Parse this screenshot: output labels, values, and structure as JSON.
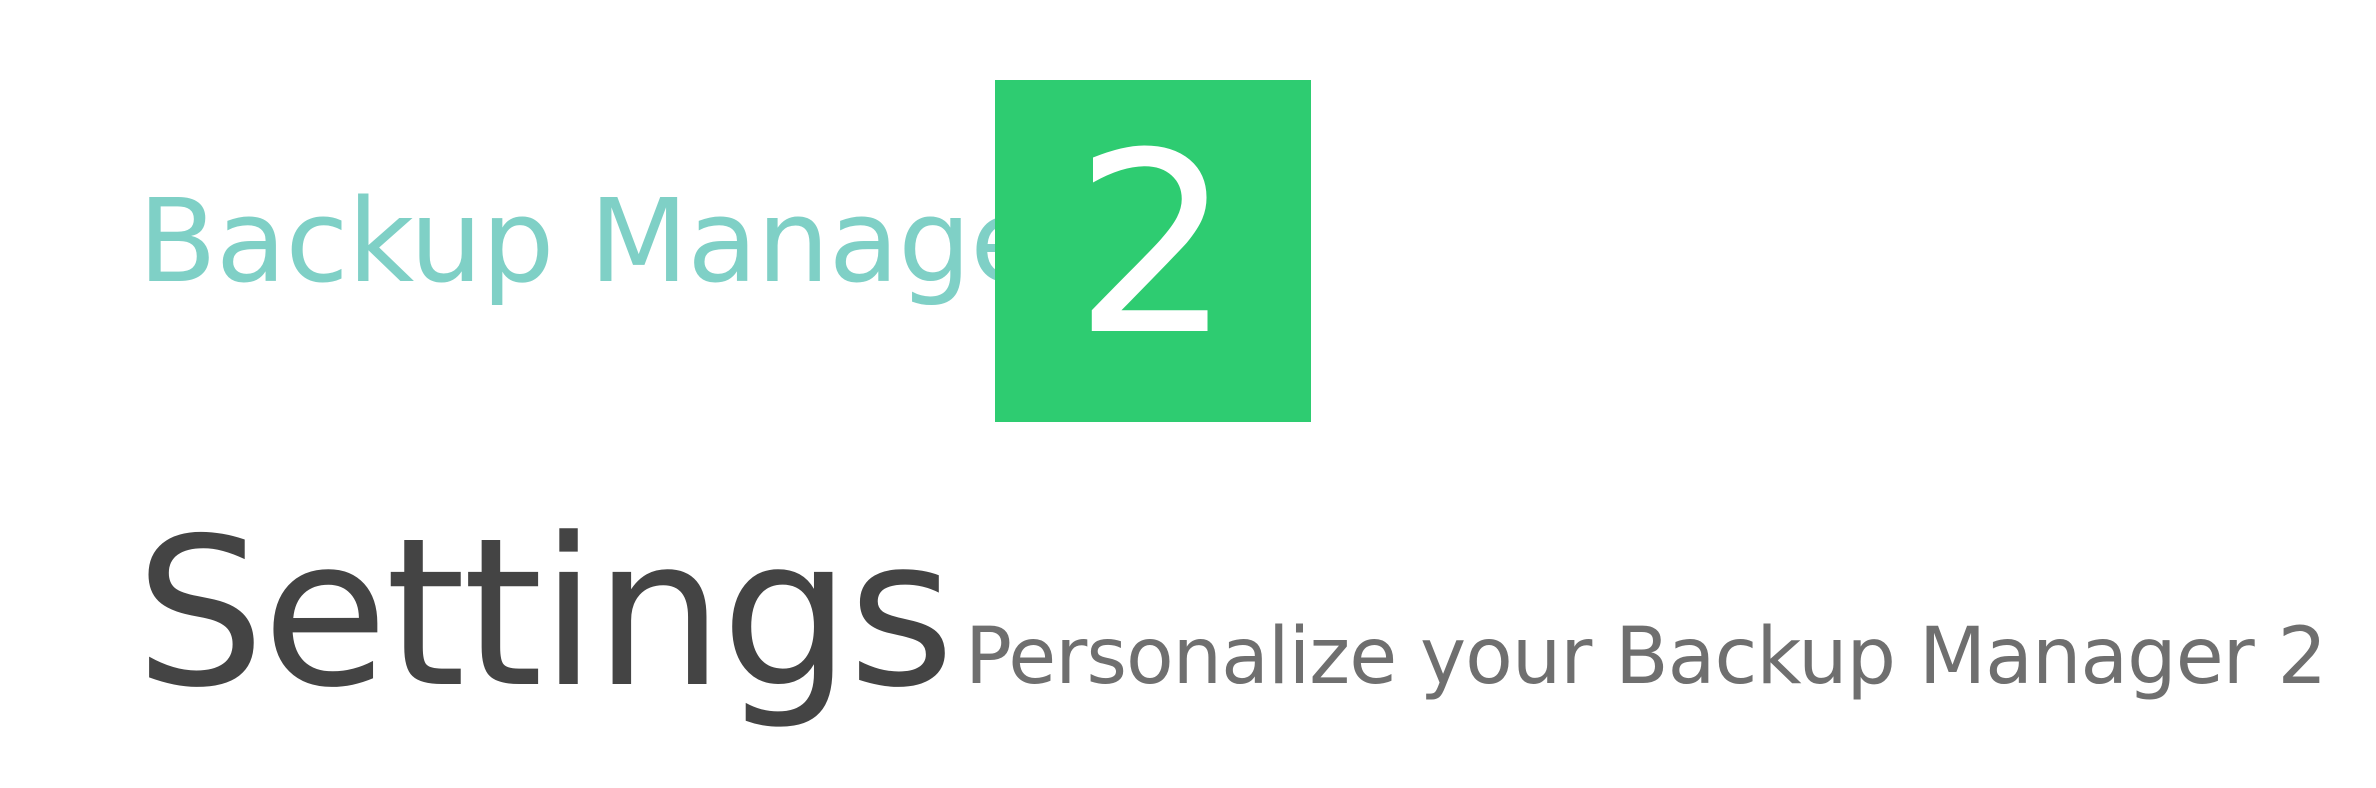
{
  "header": {
    "app_name": "Backup Manager",
    "version_badge": "2"
  },
  "page": {
    "title": "Settings",
    "subtitle": "Personalize your Backup Manager 2"
  },
  "colors": {
    "app_name": "#7fd0c6",
    "version_badge_bg": "#2ecc71",
    "version_badge_text": "#ffffff",
    "page_title": "#444444",
    "page_subtitle": "#6f6f6f",
    "background": "#ffffff"
  }
}
